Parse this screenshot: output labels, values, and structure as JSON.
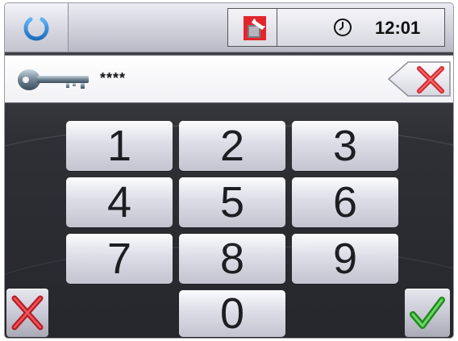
{
  "topbar": {
    "power_icon": "power-icon",
    "memory_icon": "memory-card-icon",
    "clock_icon": "clock-icon",
    "time": "12:01"
  },
  "code_entry": {
    "key_icon": "key-icon",
    "value": "****",
    "backspace_icon": "backspace-x-icon"
  },
  "keypad": {
    "keys": [
      "1",
      "2",
      "3",
      "4",
      "5",
      "6",
      "7",
      "8",
      "9",
      "0"
    ]
  },
  "actions": {
    "cancel_icon": "red-x-icon",
    "confirm_icon": "green-check-icon"
  },
  "colors": {
    "power_blue": "#2a8ad6",
    "cancel_red": "#d9272e",
    "confirm_green": "#2fa52a",
    "background_dark": "#2f3036"
  }
}
